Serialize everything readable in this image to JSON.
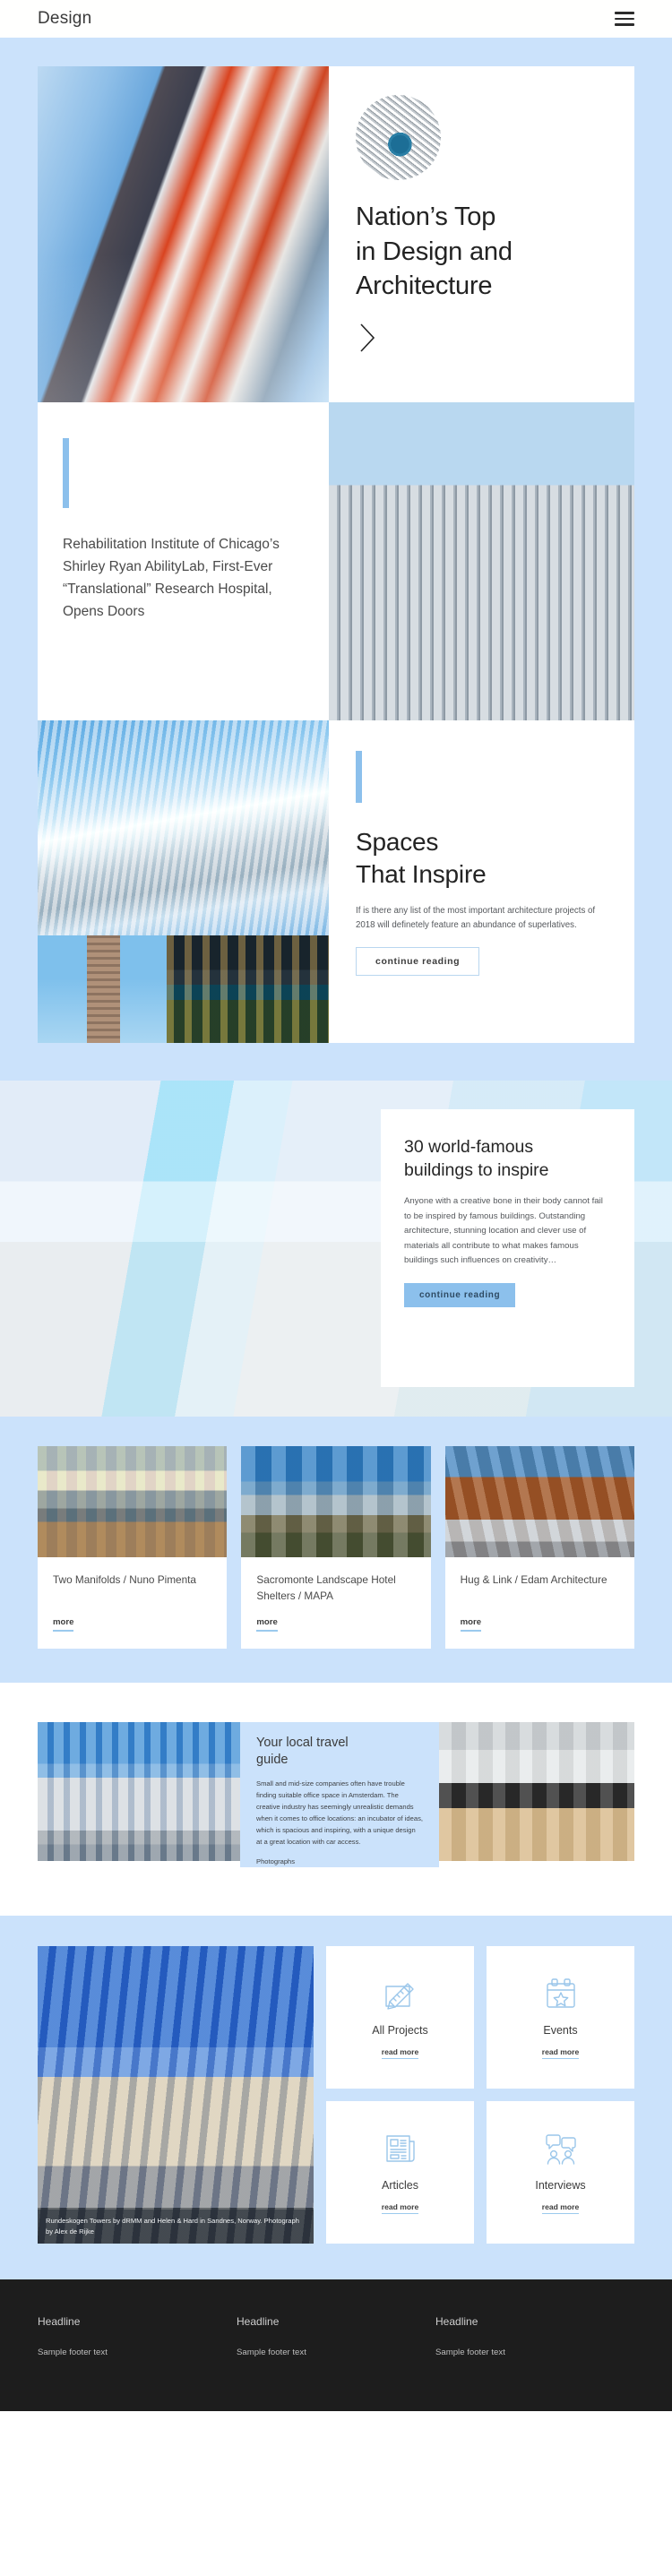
{
  "header": {
    "brand": "Design",
    "menu_icon": "hamburger-menu-icon"
  },
  "colors": {
    "page_blue": "#cbe2fb",
    "accent_blue": "#8cc0ec",
    "link_underline": "#9bcaee",
    "footer_bg": "#1d1d1d",
    "text_dark": "#232323"
  },
  "hero": {
    "title": "Nation’s Top\nin Design and\nArchitecture",
    "title_lines": [
      "Nation’s Top",
      "in Design and",
      "Architecture"
    ],
    "thumb_alt": "circular-building-thumbnail",
    "next_arrow": "chevron-right-icon"
  },
  "feature": {
    "text": "Rehabilitation Institute of Chicago’s Shirley Ryan AbilityLab, First-Ever “Translational” Research Hospital, Opens Doors"
  },
  "spaces": {
    "title_lines": [
      "Spaces",
      "That Inspire"
    ],
    "body": "If is there any list of the most important architecture projects of 2018 will definetely feature an abundance of superlatives.",
    "button": "continue reading"
  },
  "banner": {
    "title_lines": [
      "30 world-famous",
      "buildings to inspire"
    ],
    "body": "Anyone with a creative bone in their body cannot fail to be inspired by famous buildings. Outstanding architecture, stunning location and clever use of materials all contribute to what makes famous buildings such influences on creativity…",
    "button": "continue reading"
  },
  "cards": {
    "more_label": "more",
    "items": [
      {
        "title": "Two Manifolds / Nuno Pimenta",
        "image": "lookout-tower-photo"
      },
      {
        "title": "Sacromonte Landscape Hotel Shelters / MAPA",
        "image": "mirrored-shelter-photo"
      },
      {
        "title": "Hug & Link / Edam Architecture",
        "image": "timber-building-photo"
      }
    ]
  },
  "travel_guide": {
    "title_lines": [
      "Your local travel",
      "guide"
    ],
    "body": "Small and mid-size companies often have trouble finding suitable office space in Amsterdam. The creative industry has seemingly unrealistic demands when it comes to office locations: an incubator of ideas, which is spacious and inspiring, with a unique design at a great location with car access.",
    "footnote": "Photographs",
    "left_image": "office-street-photo",
    "right_image": "interior-stairs-photo"
  },
  "projects": {
    "photo_caption": "Rundeskogen Towers by dRMM and Helen & Hard in Sandnes, Norway. Photograph by Alex de Rijke",
    "read_more_label": "read more",
    "tiles": [
      {
        "label": "All Projects",
        "icon": "ruler-pencil-icon"
      },
      {
        "label": "Events",
        "icon": "calendar-star-icon"
      },
      {
        "label": "Articles",
        "icon": "newspaper-icon"
      },
      {
        "label": "Interviews",
        "icon": "speech-people-icon"
      }
    ]
  },
  "footer": {
    "columns": [
      {
        "headline": "Headline",
        "text": "Sample footer text"
      },
      {
        "headline": "Headline",
        "text": "Sample footer text"
      },
      {
        "headline": "Headline",
        "text": "Sample footer text"
      }
    ]
  }
}
